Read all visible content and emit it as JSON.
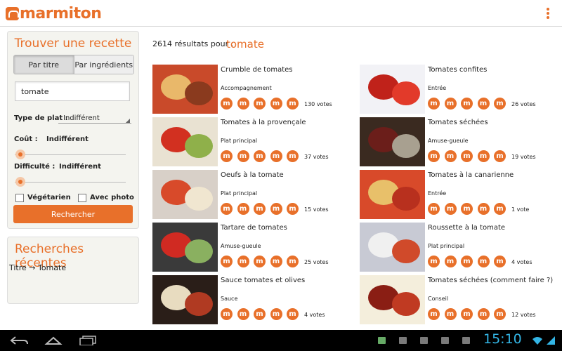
{
  "app": {
    "logo_text": "marmiton",
    "accent": "#e8702a"
  },
  "search_panel": {
    "title": "Trouver une recette",
    "tabs": [
      "Par titre",
      "Par ingrédients"
    ],
    "active_tab": 0,
    "query_value": "tomate",
    "dish_type_label": "Type de plat :",
    "dish_type_value": "Indifférent",
    "cost_label": "Coût :",
    "cost_value": "Indifférent",
    "difficulty_label": "Difficulté :",
    "difficulty_value": "Indifférent",
    "vegetarian_label": "Végétarien",
    "with_photo_label": "Avec photo",
    "search_button": "Rechercher"
  },
  "recent_panel": {
    "title": "Recherches récentes",
    "items": [
      "Titre → Tomate"
    ]
  },
  "results": {
    "count_text": "2614 résultats pour :",
    "query": "tomate",
    "items": [
      {
        "title": "Crumble de tomates",
        "category": "Accompagnement",
        "votes": "130 votes"
      },
      {
        "title": "Tomates confites",
        "category": "Entrée",
        "votes": "26 votes"
      },
      {
        "title": "Tomates à la provençale",
        "category": "Plat principal",
        "votes": "37 votes"
      },
      {
        "title": "Tomates séchées",
        "category": "Amuse-gueule",
        "votes": "19 votes"
      },
      {
        "title": "Oeufs à la tomate",
        "category": "Plat principal",
        "votes": "15 votes"
      },
      {
        "title": "Tomates à la canarienne",
        "category": "Entrée",
        "votes": "1 vote"
      },
      {
        "title": "Tartare de tomates",
        "category": "Amuse-gueule",
        "votes": "25 votes"
      },
      {
        "title": "Roussette à la tomate",
        "category": "Plat principal",
        "votes": "4 votes"
      },
      {
        "title": "Sauce tomates et olives",
        "category": "Sauce",
        "votes": "4 votes"
      },
      {
        "title": "Tomates séchées (comment faire ?)",
        "category": "Conseil",
        "votes": "12 votes"
      }
    ],
    "rating_glyph": "m"
  },
  "system_bar": {
    "time": "15:10"
  }
}
